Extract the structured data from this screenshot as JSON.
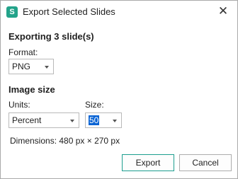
{
  "window": {
    "title": "Export Selected Slides",
    "app_icon_letter": "S",
    "accent": "#23a38a"
  },
  "export": {
    "heading": "Exporting 3 slide(s)",
    "format_label": "Format:",
    "format_value": "PNG"
  },
  "image_size": {
    "heading": "Image size",
    "units_label": "Units:",
    "units_value": "Percent",
    "size_label": "Size:",
    "size_value": "50",
    "dimensions": "Dimensions: 480 px × 270 px"
  },
  "buttons": {
    "export": "Export",
    "cancel": "Cancel"
  },
  "colors": {
    "selection": "#0a64d4",
    "primary_border": "#1d9e8f"
  }
}
